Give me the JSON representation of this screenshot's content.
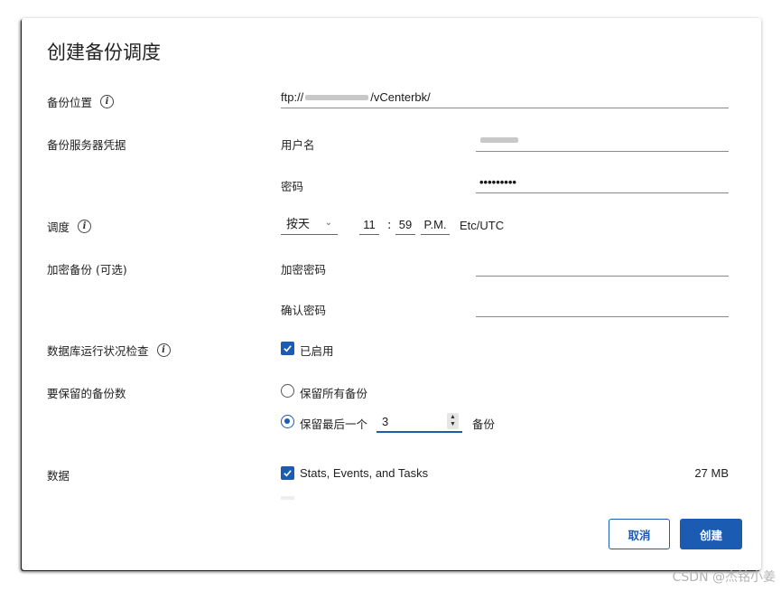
{
  "dialog": {
    "title": "创建备份调度",
    "location": {
      "label": "备份位置",
      "value_prefix": "ftp://",
      "value_suffix": "/vCenterbk/"
    },
    "credentials": {
      "label": "备份服务器凭据",
      "username_label": "用户名",
      "password_label": "密码",
      "password_value": "•••••••••"
    },
    "schedule": {
      "label": "调度",
      "frequency": "按天",
      "hour": "11",
      "separator": ":",
      "minute": "59",
      "ampm": "P.M.",
      "timezone": "Etc/UTC"
    },
    "encryption": {
      "label": "加密备份 (可选)",
      "password_label": "加密密码",
      "confirm_label": "确认密码"
    },
    "health_check": {
      "label": "数据库运行状况检查",
      "option": "已启用",
      "checked": true
    },
    "retention": {
      "label": "要保留的备份数",
      "keep_all": "保留所有备份",
      "keep_last": "保留最后一个",
      "count": "3",
      "unit": "备份",
      "selected": "keep_last"
    },
    "data": {
      "label": "数据",
      "item": "Stats, Events, and Tasks",
      "size": "27 MB",
      "checked": true
    },
    "buttons": {
      "cancel": "取消",
      "create": "创建"
    }
  },
  "watermark": "CSDN @杰铭小姜",
  "colors": {
    "accent": "#1b5bb2"
  }
}
